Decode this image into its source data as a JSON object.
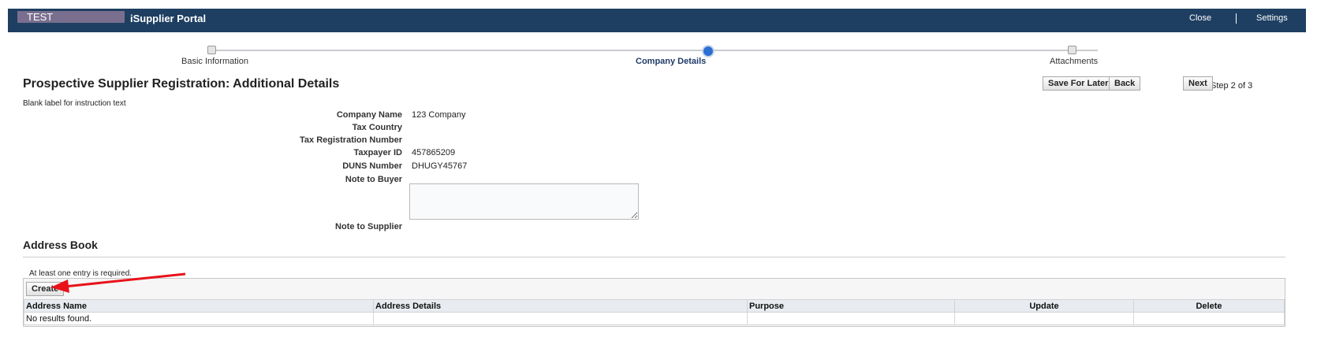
{
  "header": {
    "env_label": "TEST",
    "app_title": "iSupplier Portal",
    "close_label": "Close",
    "settings_label": "Settings"
  },
  "train": {
    "steps": [
      {
        "label": "Basic Information",
        "state": "done"
      },
      {
        "label": "Company Details",
        "state": "current"
      },
      {
        "label": "Attachments",
        "state": "pending"
      }
    ]
  },
  "page": {
    "title": "Prospective Supplier Registration: Additional Details",
    "instruction": "Blank label for instruction text",
    "save_label": "Save For Later",
    "back_label": "Back",
    "step_text": "Step 2 of 3",
    "next_label": "Next"
  },
  "form": {
    "company_name": {
      "label": "Company Name",
      "value": "123 Company"
    },
    "tax_country": {
      "label": "Tax Country",
      "value": ""
    },
    "tax_reg": {
      "label": "Tax Registration Number",
      "value": ""
    },
    "taxpayer_id": {
      "label": "Taxpayer ID",
      "value": "457865209"
    },
    "duns": {
      "label": "DUNS Number",
      "value": "DHUGY45767"
    },
    "note_buyer": {
      "label": "Note to Buyer",
      "value": ""
    },
    "note_supplier": {
      "label": "Note to Supplier",
      "value": ""
    }
  },
  "address_book": {
    "title": "Address Book",
    "required_text": "At least one entry is required.",
    "create_label": "Create",
    "columns": [
      "Address Name",
      "Address Details",
      "Purpose",
      "Update",
      "Delete"
    ],
    "empty_text": "No results found."
  },
  "colors": {
    "header_bg": "#1e3f62",
    "annotation_arrow": "#e8131a"
  }
}
